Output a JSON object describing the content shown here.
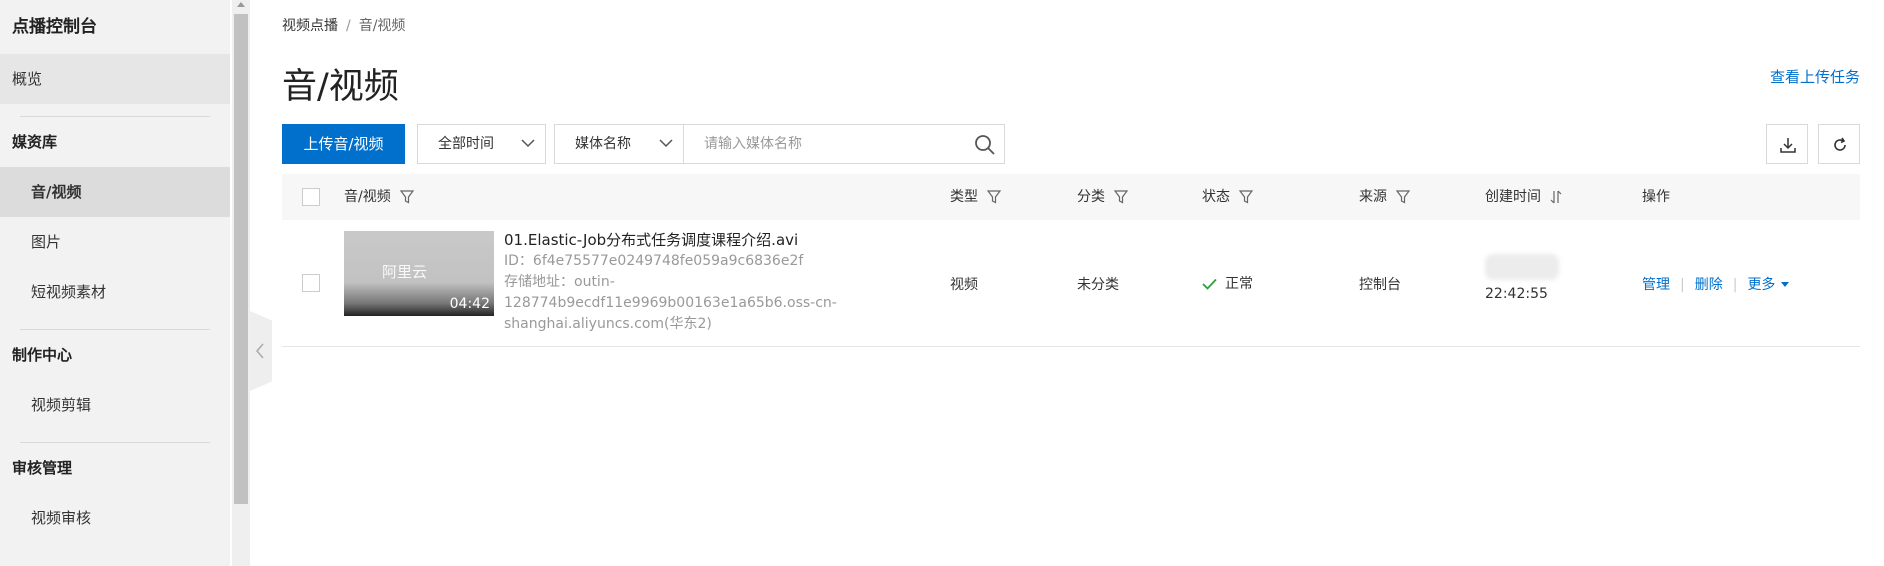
{
  "sidebar": {
    "app_title": "点播控制台",
    "overview": "概览",
    "media_library": {
      "title": "媒资库",
      "items": [
        "音/视频",
        "图片",
        "短视频素材"
      ]
    },
    "production_center": {
      "title": "制作中心",
      "items": [
        "视频剪辑"
      ]
    },
    "review_management": {
      "title": "审核管理",
      "items": [
        "视频审核"
      ]
    }
  },
  "breadcrumb": [
    "视频点播",
    "音/视频"
  ],
  "page_title": "音/视频",
  "upload_tasks_link": "查看上传任务",
  "toolbar": {
    "upload_button": "上传音/视频",
    "time_filter": "全部时间",
    "search_field_select": "媒体名称",
    "search_placeholder": "请输入媒体名称"
  },
  "table": {
    "columns": [
      "音/视频",
      "类型",
      "分类",
      "状态",
      "来源",
      "创建时间",
      "操作"
    ],
    "rows": [
      {
        "name": "01.Elastic-Job分布式任务调度课程介绍.avi",
        "id": "ID：6f4e75577e0249748fe059a9c6836e2f",
        "storage_line1": "存储地址：outin-",
        "storage_line2": "128774b9ecdf11e9969b00163e1a65b6.oss-cn-",
        "storage_line3": "shanghai.aliyuncs.com(华东2)",
        "thumbnail_logo": "阿里云",
        "duration": "04:42",
        "type": "视频",
        "category": "未分类",
        "status": "正常",
        "source": "控制台",
        "created_time": "22:42:55",
        "actions": [
          "管理",
          "删除",
          "更多"
        ]
      }
    ]
  },
  "colors": {
    "accent": "#0070cc",
    "status_ok": "#2e9e3e",
    "sidebar_bg": "#f2f2f2"
  }
}
